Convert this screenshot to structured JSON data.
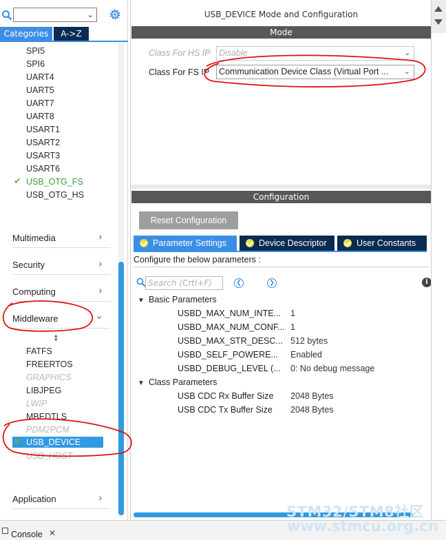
{
  "left": {
    "tabs": [
      "Categories",
      "A->Z"
    ],
    "peripherals": [
      "SPI5",
      "SPI6",
      "UART4",
      "UART5",
      "UART7",
      "UART8",
      "USART1",
      "USART2",
      "USART3",
      "USART6",
      "USB_OTG_FS",
      "USB_OTG_HS"
    ],
    "categories": [
      "Multimedia",
      "Security",
      "Computing",
      "Middleware"
    ],
    "middleware": [
      "FATFS",
      "FREERTOS",
      "GRAPHICS",
      "LIBJPEG",
      "LWIP",
      "MBEDTLS",
      "PDM2PCM",
      "USB_DEVICE",
      "USB_HOST"
    ],
    "application": "Application"
  },
  "right": {
    "title": "USB_DEVICE Mode and Configuration",
    "mode_header": "Mode",
    "hs_label": "Class For HS IP",
    "hs_value": "Disable",
    "fs_label": "Class For FS IP",
    "fs_value": "Communication Device Class (Virtual Port ...",
    "config_header": "Configuration",
    "reset_button": "Reset Configuration",
    "tabs": [
      "Parameter Settings",
      "Device Descriptor",
      "User Constants"
    ],
    "configure_text": "Configure the below parameters :",
    "search_placeholder": "Search (Crtl+F)",
    "groups": [
      {
        "name": "Basic Parameters",
        "params": [
          {
            "name": "USBD_MAX_NUM_INTE...",
            "value": "1"
          },
          {
            "name": "USBD_MAX_NUM_CONF...",
            "value": "1"
          },
          {
            "name": "USBD_MAX_STR_DESC...",
            "value": "512 bytes"
          },
          {
            "name": "USBD_SELF_POWERE...",
            "value": "Enabled"
          },
          {
            "name": "USBD_DEBUG_LEVEL (...",
            "value": "0: No debug message"
          }
        ]
      },
      {
        "name": "Class Parameters",
        "params": [
          {
            "name": "USB CDC Rx Buffer Size",
            "value": "2048 Bytes"
          },
          {
            "name": "USB CDC Tx Buffer Size",
            "value": "2048 Bytes"
          }
        ]
      }
    ]
  },
  "console": {
    "label": "Console"
  },
  "watermark": {
    "line1": "STM32/STM8社区",
    "line2": "www.stmcu.org.cn"
  },
  "colors": {
    "accent": "#3c8ee5",
    "dark_tab": "#0b2b52",
    "header_bar": "#575757",
    "check_green": "#7ab829",
    "annotation_red": "#e01010"
  }
}
